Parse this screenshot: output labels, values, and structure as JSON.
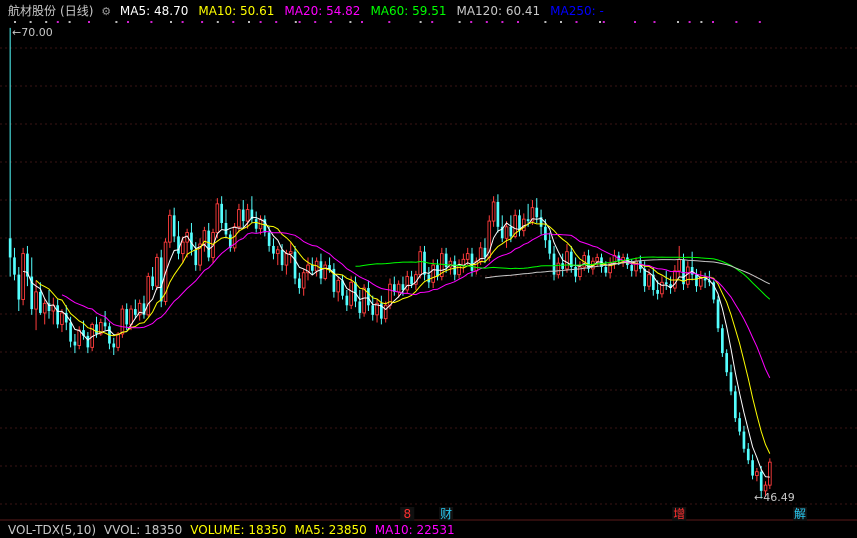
{
  "header": {
    "stock_name": "航材股份",
    "period": "(日线)",
    "indicators": [
      {
        "label": "MA5:",
        "value": "48.70",
        "color": "#ffffff"
      },
      {
        "label": "MA10:",
        "value": "50.61",
        "color": "#ffff00"
      },
      {
        "label": "MA20:",
        "value": "54.82",
        "color": "#ff00ff"
      },
      {
        "label": "MA60:",
        "value": "59.51",
        "color": "#00ff00"
      },
      {
        "label": "MA120:",
        "value": "60.41",
        "color": "#c8c8c8"
      },
      {
        "label": "MA250:",
        "value": "-",
        "color": "#0000ff"
      }
    ]
  },
  "volume_bar": {
    "name": "VOL-TDX(5,10)",
    "items": [
      {
        "label": "VVOL:",
        "value": "18350",
        "color": "#c8c8c8"
      },
      {
        "label": "VOLUME:",
        "value": "18350",
        "color": "#ffff00"
      },
      {
        "label": "MA5:",
        "value": "23850",
        "color": "#ffff00"
      },
      {
        "label": "MA10:",
        "value": "22531",
        "color": "#ff00ff"
      }
    ]
  },
  "chart_data": {
    "type": "candlestick",
    "y_range": [
      45.8,
      71.2
    ],
    "annotations": [
      {
        "label": "70.00",
        "value": 70.0
      },
      {
        "label": "46.49",
        "value": 46.49
      }
    ],
    "event_markers": [
      {
        "label": "8",
        "index": 92,
        "color": "#ff3030"
      },
      {
        "label": "财",
        "index": 101,
        "color": "#29c8f0"
      },
      {
        "label": "增",
        "index": 155,
        "color": "#ff3030"
      },
      {
        "label": "解",
        "index": 183,
        "color": "#29c8f0"
      }
    ],
    "up_color": "#ff3c3c",
    "down_color": "#54ffff",
    "candles": [
      [
        60,
        71,
        58,
        59
      ],
      [
        59,
        59.5,
        57.8,
        58.1
      ],
      [
        58.1,
        58.5,
        56.2,
        56.8
      ],
      [
        56.8,
        59.5,
        56.5,
        59.2
      ],
      [
        59.2,
        59.6,
        57.5,
        58
      ],
      [
        58,
        59,
        56,
        56.3
      ],
      [
        56.3,
        57.8,
        55.2,
        57.2
      ],
      [
        57.2,
        57.7,
        56,
        56.1
      ],
      [
        56.1,
        56.8,
        55.5,
        56.6
      ],
      [
        56.6,
        57.3,
        55.8,
        56.2
      ],
      [
        56.2,
        56.9,
        55.5,
        56.5
      ],
      [
        56.5,
        56.8,
        55.3,
        55.5
      ],
      [
        55.5,
        56.3,
        55.1,
        56.1
      ],
      [
        56.1,
        56.5,
        55.2,
        55.6
      ],
      [
        55.6,
        55.9,
        54.3,
        54.6
      ],
      [
        54.6,
        55,
        54,
        54.4
      ],
      [
        54.4,
        55.4,
        54.2,
        55.2
      ],
      [
        55.2,
        55.7,
        54.7,
        54.9
      ],
      [
        54.9,
        55.1,
        54,
        54.3
      ],
      [
        54.3,
        55.6,
        54.1,
        55.5
      ],
      [
        55.5,
        55.9,
        54.8,
        55
      ],
      [
        55,
        55.8,
        54.9,
        55.6
      ],
      [
        55.6,
        56.2,
        55.2,
        55.4
      ],
      [
        55.4,
        55.6,
        54.2,
        54.5
      ],
      [
        54.5,
        54.8,
        53.9,
        54.3
      ],
      [
        54.3,
        55.1,
        54.1,
        55
      ],
      [
        55,
        56.5,
        54.8,
        56.3
      ],
      [
        56.3,
        56.6,
        55.2,
        55.5
      ],
      [
        55.5,
        56.5,
        55.2,
        56.3
      ],
      [
        56.3,
        56.8,
        55.8,
        56
      ],
      [
        56,
        56.8,
        55.7,
        56.6
      ],
      [
        56.6,
        57,
        55.8,
        56
      ],
      [
        56,
        58.2,
        55.9,
        58
      ],
      [
        58,
        58.5,
        57.3,
        57.5
      ],
      [
        57.5,
        59.2,
        57.3,
        59
      ],
      [
        59,
        59.4,
        56.4,
        56.7
      ],
      [
        56.7,
        60,
        56.5,
        59.8
      ],
      [
        59.8,
        61.5,
        59.5,
        61.2
      ],
      [
        61.2,
        61.6,
        59.8,
        60.1
      ],
      [
        60.1,
        60.9,
        58.9,
        59.2
      ],
      [
        59.2,
        60.1,
        58.7,
        59.8
      ],
      [
        59.8,
        60.5,
        59,
        60.3
      ],
      [
        60.3,
        60.8,
        59.1,
        59.4
      ],
      [
        59.4,
        59.8,
        58.3,
        58.6
      ],
      [
        58.6,
        60,
        58.3,
        59.7
      ],
      [
        59.7,
        60.6,
        59.3,
        60.4
      ],
      [
        60.4,
        60.8,
        58.8,
        59
      ],
      [
        59,
        60.5,
        58.7,
        60.3
      ],
      [
        60.3,
        62.1,
        60,
        61.8
      ],
      [
        61.8,
        62.2,
        60.5,
        60.8
      ],
      [
        60.8,
        61.5,
        60,
        60.2
      ],
      [
        60.2,
        60.4,
        59.3,
        59.5
      ],
      [
        59.5,
        60.8,
        59.3,
        60.6
      ],
      [
        60.6,
        61.8,
        60.3,
        61.5
      ],
      [
        61.5,
        62,
        60.6,
        60.9
      ],
      [
        60.9,
        61.8,
        60.5,
        61.5
      ],
      [
        61.5,
        62.2,
        60.8,
        61
      ],
      [
        61,
        61.4,
        60.3,
        60.5
      ],
      [
        60.5,
        61.2,
        60.2,
        61
      ],
      [
        61,
        61.2,
        60.1,
        60.3
      ],
      [
        60.3,
        60.6,
        59.3,
        59.6
      ],
      [
        59.6,
        60,
        58.9,
        59.2
      ],
      [
        59.2,
        59.6,
        58.6,
        59.4
      ],
      [
        59.4,
        59.7,
        58.3,
        58.6
      ],
      [
        58.6,
        59.4,
        58.1,
        59.2
      ],
      [
        59.2,
        59.8,
        58.7,
        59.3
      ],
      [
        59.3,
        59.6,
        57.6,
        57.9
      ],
      [
        57.9,
        58.2,
        57.1,
        57.4
      ],
      [
        57.4,
        58.4,
        57,
        58.2
      ],
      [
        58.2,
        59,
        57.8,
        58.6
      ],
      [
        58.6,
        59,
        58.1,
        58.3
      ],
      [
        58.3,
        59,
        58,
        58.8
      ],
      [
        58.8,
        59.2,
        57.6,
        57.9
      ],
      [
        57.9,
        58.8,
        57.8,
        58.6
      ],
      [
        58.6,
        59,
        58.2,
        58.4
      ],
      [
        58.4,
        58.7,
        56.9,
        57.2
      ],
      [
        57.2,
        58,
        56.7,
        57.8
      ],
      [
        57.8,
        58.1,
        56.8,
        57
      ],
      [
        57,
        57.3,
        56.2,
        56.5
      ],
      [
        56.5,
        58,
        56.3,
        57.7
      ],
      [
        57.7,
        58,
        56.4,
        56.7
      ],
      [
        56.7,
        57.3,
        55.8,
        56.1
      ],
      [
        56.1,
        57.6,
        55.9,
        57.4
      ],
      [
        57.4,
        57.8,
        56.2,
        56.5
      ],
      [
        56.5,
        57,
        55.7,
        56
      ],
      [
        56,
        56.8,
        55.6,
        56.6
      ],
      [
        56.6,
        57,
        55.5,
        55.8
      ],
      [
        55.8,
        56.7,
        55.6,
        56.5
      ],
      [
        56.5,
        57.9,
        56.3,
        57.6
      ],
      [
        57.6,
        58,
        57,
        57.2
      ],
      [
        57.2,
        57.8,
        56.9,
        57.6
      ],
      [
        57.6,
        58,
        57,
        57.3
      ],
      [
        57.3,
        58.3,
        57.1,
        58
      ],
      [
        58,
        58.3,
        57.4,
        57.6
      ],
      [
        57.6,
        58.3,
        57.3,
        58.1
      ],
      [
        58.1,
        59.6,
        57.9,
        59.3
      ],
      [
        59.3,
        59.6,
        57.8,
        58.1
      ],
      [
        58.1,
        58.5,
        57.4,
        57.7
      ],
      [
        57.7,
        58.9,
        57.4,
        58.6
      ],
      [
        58.6,
        58.9,
        57.8,
        58
      ],
      [
        58,
        59.5,
        57.8,
        59.2
      ],
      [
        59.2,
        59.5,
        58.2,
        58.5
      ],
      [
        58.5,
        59,
        58.1,
        58.8
      ],
      [
        58.8,
        59.1,
        57.8,
        58.1
      ],
      [
        58.1,
        58.9,
        57.9,
        58.6
      ],
      [
        58.6,
        59.2,
        58.2,
        58.9
      ],
      [
        58.9,
        59.5,
        58.6,
        59.2
      ],
      [
        59.2,
        59.5,
        58,
        58.3
      ],
      [
        58.3,
        59,
        58.1,
        58.8
      ],
      [
        58.8,
        59.8,
        58.6,
        59.5
      ],
      [
        59.5,
        60,
        58.7,
        59
      ],
      [
        59,
        61.2,
        58.8,
        60.9
      ],
      [
        60.9,
        62.2,
        60.6,
        61.9
      ],
      [
        61.9,
        62.3,
        60.3,
        60.6
      ],
      [
        60.6,
        61.2,
        59.8,
        60
      ],
      [
        60,
        60.9,
        59.5,
        60.6
      ],
      [
        60.6,
        61.2,
        59.8,
        60.1
      ],
      [
        60.1,
        61.5,
        60,
        61.2
      ],
      [
        61.2,
        61.5,
        60.1,
        60.4
      ],
      [
        60.4,
        61.3,
        60.1,
        61
      ],
      [
        61,
        61.8,
        60.6,
        60.9
      ],
      [
        60.9,
        62,
        60.7,
        61.6
      ],
      [
        61.6,
        62.1,
        60.8,
        61.1
      ],
      [
        61.1,
        61.5,
        60.2,
        60.6
      ],
      [
        60.6,
        61,
        59.5,
        59.9
      ],
      [
        59.9,
        60.3,
        58.9,
        59.2
      ],
      [
        59.2,
        59.6,
        57.8,
        58.1
      ],
      [
        58.1,
        59,
        57.9,
        58.7
      ],
      [
        58.7,
        59.2,
        58,
        58.4
      ],
      [
        58.4,
        59.7,
        58.2,
        59.3
      ],
      [
        59.3,
        59.6,
        58.2,
        58.5
      ],
      [
        58.5,
        59,
        57.7,
        58
      ],
      [
        58,
        58.8,
        57.8,
        58.5
      ],
      [
        58.5,
        59.3,
        58.3,
        59.1
      ],
      [
        59.1,
        59.4,
        58.2,
        58.4
      ],
      [
        58.4,
        59,
        58.1,
        58.8
      ],
      [
        58.8,
        59.2,
        58.5,
        59
      ],
      [
        59,
        59.2,
        58.2,
        58.5
      ],
      [
        58.5,
        58.8,
        58,
        58.2
      ],
      [
        58.2,
        59,
        57.9,
        58.7
      ],
      [
        58.7,
        59.4,
        58.4,
        59.1
      ],
      [
        59.1,
        59.3,
        58.6,
        58.8
      ],
      [
        58.8,
        59.2,
        58.5,
        59
      ],
      [
        59,
        59.2,
        58.4,
        58.6
      ],
      [
        58.6,
        58.9,
        58,
        58.3
      ],
      [
        58.3,
        59,
        58,
        58.8
      ],
      [
        58.8,
        59.1,
        58.2,
        58.4
      ],
      [
        58.4,
        58.8,
        57.2,
        57.5
      ],
      [
        57.5,
        58.4,
        57.3,
        58.1
      ],
      [
        58.1,
        58.5,
        57,
        57.3
      ],
      [
        57.3,
        57.8,
        56.8,
        57.1
      ],
      [
        57.1,
        58,
        56.9,
        57.7
      ],
      [
        57.7,
        58.3,
        57.3,
        57.6
      ],
      [
        57.6,
        58,
        57.1,
        57.4
      ],
      [
        57.4,
        58.6,
        57.2,
        58.3
      ],
      [
        58.3,
        59.6,
        58,
        58.9
      ],
      [
        58.9,
        59.2,
        57.3,
        57.6
      ],
      [
        57.6,
        58.8,
        57.4,
        58.5
      ],
      [
        58.5,
        59.3,
        57.8,
        58.1
      ],
      [
        58.1,
        58.4,
        57.2,
        57.5
      ],
      [
        57.5,
        58.3,
        57.3,
        57.9
      ],
      [
        57.9,
        58.2,
        57.4,
        57.8
      ],
      [
        57.8,
        58.3,
        57.5,
        57.7
      ],
      [
        57.7,
        57.8,
        56.6,
        56.8
      ],
      [
        56.8,
        57,
        55.1,
        55.3
      ],
      [
        55.3,
        55.5,
        53.8,
        54
      ],
      [
        54,
        54.2,
        52.8,
        53
      ],
      [
        53,
        53.4,
        51.8,
        52
      ],
      [
        52,
        52.3,
        50.4,
        50.6
      ],
      [
        50.6,
        50.9,
        49.7,
        49.9
      ],
      [
        49.9,
        50.2,
        48.8,
        49
      ],
      [
        49,
        49.3,
        48.2,
        48.4
      ],
      [
        48.4,
        48.7,
        47.4,
        47.6
      ],
      [
        47.6,
        48,
        47.3,
        47.8
      ],
      [
        47.8,
        48.1,
        46.4,
        46.8
      ],
      [
        46.8,
        47.3,
        46.5,
        47.1
      ],
      [
        47.1,
        48.5,
        46.9,
        48.3
      ]
    ]
  }
}
